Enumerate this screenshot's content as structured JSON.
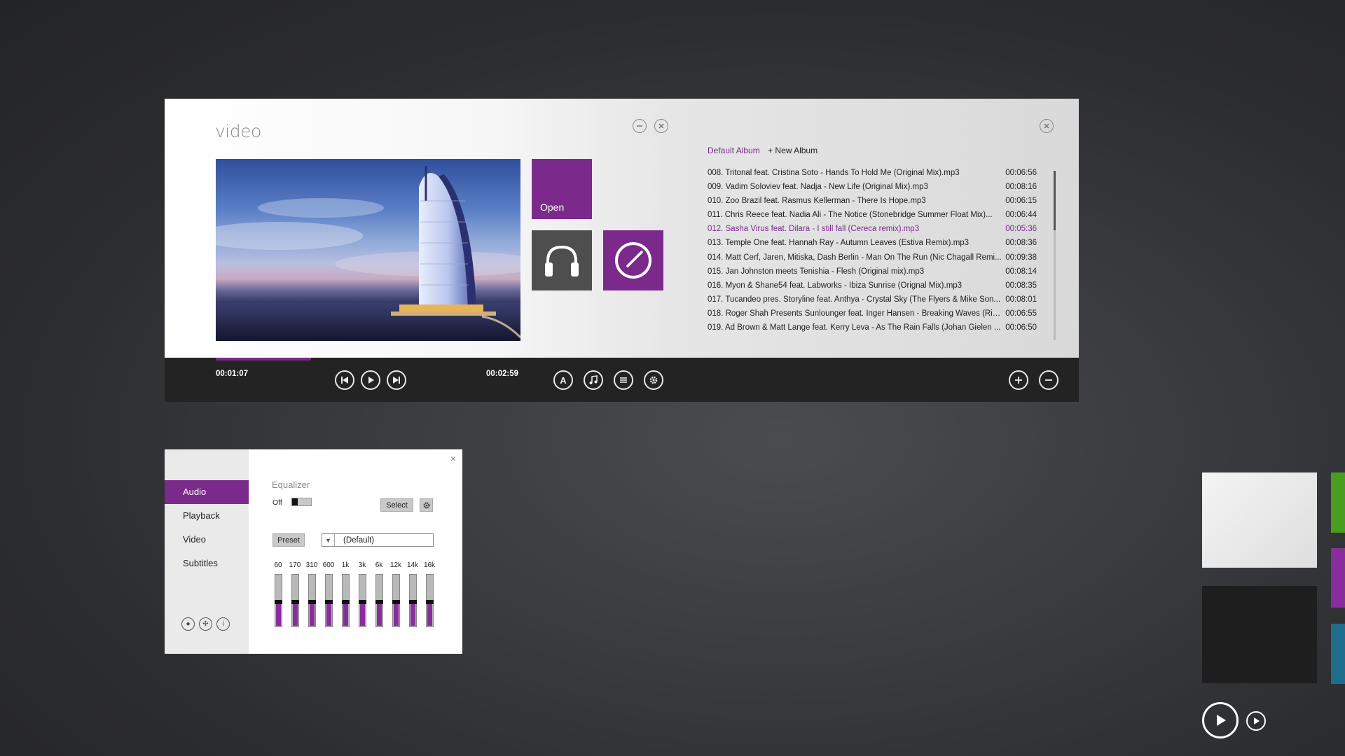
{
  "player": {
    "title": "video",
    "tiles": {
      "open_label": "Open"
    },
    "album": {
      "default": "Default Album",
      "new": "+ New Album"
    },
    "playlist": [
      {
        "title": "008. Tritonal feat. Cristina Soto - Hands To Hold Me (Original Mix).mp3",
        "duration": "00:06:56"
      },
      {
        "title": "009. Vadim Soloviev feat. Nadja - New Life (Original Mix).mp3",
        "duration": "00:08:16"
      },
      {
        "title": "010. Zoo Brazil feat. Rasmus Kellerman - There Is Hope.mp3",
        "duration": "00:06:15"
      },
      {
        "title": "011. Chris Reece feat. Nadia Ali - The Notice (Stonebridge Summer Float Mix)...",
        "duration": "00:06:44"
      },
      {
        "title": "012. Sasha Virus feat. Dilara - I still fall (Cereca remix).mp3",
        "duration": "00:05:36",
        "active": true
      },
      {
        "title": "013. Temple One feat. Hannah Ray - Autumn Leaves (Estiva Remix).mp3",
        "duration": "00:08:36"
      },
      {
        "title": "014. Matt Cerf, Jaren, Mitiska, Dash Berlin - Man On The Run (Nic Chagall Remi...",
        "duration": "00:09:38"
      },
      {
        "title": "015. Jan Johnston meets Tenishia - Flesh (Original mix).mp3",
        "duration": "00:08:14"
      },
      {
        "title": "016. Myon & Shane54 feat. Labworks - Ibiza Sunrise (Orignal Mix).mp3",
        "duration": "00:08:35"
      },
      {
        "title": "017. Tucandeo pres. Storyline feat. Anthya - Crystal Sky (The Flyers & Mike Son...",
        "duration": "00:08:01"
      },
      {
        "title": "018. Roger Shah Presents Sunlounger feat. Inger Hansen - Breaking Waves (Ric...",
        "duration": "00:06:55"
      },
      {
        "title": "019. Ad Brown & Matt Lange feat. Kerry Leva - As The Rain Falls (Johan Gielen ...",
        "duration": "00:06:50"
      }
    ],
    "controls": {
      "time_current": "00:01:07",
      "time_total": "00:02:59",
      "progress": 0.118
    }
  },
  "settings": {
    "tabs": [
      "Audio",
      "Playback",
      "Video",
      "Subtitles"
    ],
    "active_tab": "Audio",
    "equalizer": {
      "title": "Equalizer",
      "toggle_label": "Off",
      "enabled": false,
      "select_label": "Select",
      "preset_label": "Preset",
      "preset_value": "(Default)",
      "bands": [
        {
          "freq": "60",
          "level": 0.5
        },
        {
          "freq": "170",
          "level": 0.5
        },
        {
          "freq": "310",
          "level": 0.5
        },
        {
          "freq": "600",
          "level": 0.5
        },
        {
          "freq": "1k",
          "level": 0.5
        },
        {
          "freq": "3k",
          "level": 0.5
        },
        {
          "freq": "6k",
          "level": 0.5
        },
        {
          "freq": "12k",
          "level": 0.5
        },
        {
          "freq": "14k",
          "level": 0.5
        },
        {
          "freq": "16k",
          "level": 0.5
        }
      ]
    }
  },
  "colors": {
    "accent": "#7b2a8c",
    "green": "#4a9e1f",
    "purple": "#8a2d9c",
    "teal": "#1f6d8c"
  }
}
